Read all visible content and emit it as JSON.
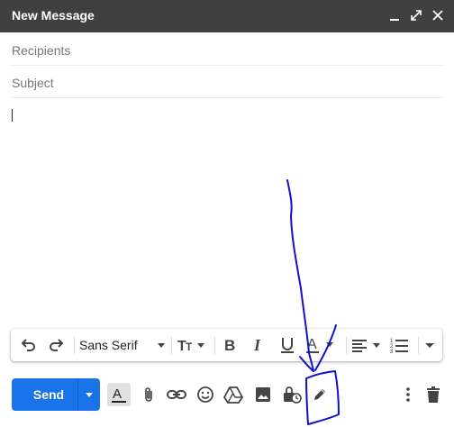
{
  "window": {
    "title": "New Message",
    "controls": [
      "minimize-icon",
      "expand-icon",
      "close-icon"
    ]
  },
  "fields": {
    "recipients_placeholder": "Recipients",
    "subject_placeholder": "Subject"
  },
  "formatting_toolbar": {
    "font_family": "Sans Serif",
    "icons": [
      "undo-icon",
      "redo-icon",
      "font-size-icon",
      "bold-icon",
      "italic-icon",
      "underline-icon",
      "text-color-icon",
      "align-icon",
      "numbered-list-icon",
      "more-formatting-icon"
    ]
  },
  "bottom_toolbar": {
    "send_label": "Send",
    "icons": [
      "formatting-options-icon",
      "attach-icon",
      "link-icon",
      "emoji-icon",
      "drive-icon",
      "photo-icon",
      "confidential-mode-icon",
      "signature-icon",
      "more-options-icon",
      "trash-icon"
    ]
  },
  "annotation": {
    "color": "#1010d0"
  }
}
